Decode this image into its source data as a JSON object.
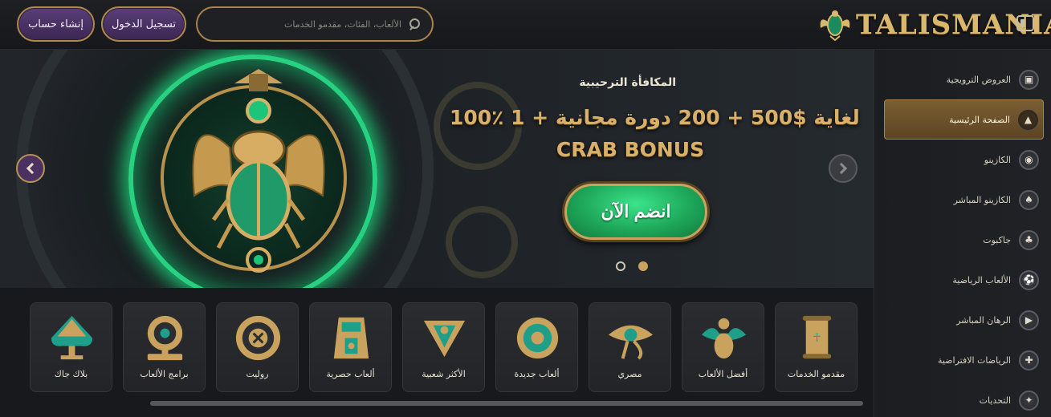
{
  "header": {
    "signup_label": "إنشاء حساب",
    "login_label": "تسجيل الدخول",
    "search_placeholder": "الألعاب، الفئات، مقدمو الخدمات",
    "logo_text": "TALISMANIA"
  },
  "hero": {
    "subtitle": "المكافأة الترحيبية",
    "line1": "100٪ لغاية $500 + 200 دورة مجانية + 1",
    "line2": "CRAB BONUS",
    "cta_label": "انضم الآن",
    "slides_total": 2,
    "active_slide": 2
  },
  "sidebar": {
    "items": [
      {
        "label": "العروض الترويجية",
        "icon": "gift-box-icon",
        "glyph": "▣",
        "active": false
      },
      {
        "label": "الصفحة الرئيسية",
        "icon": "pyramid-icon",
        "glyph": "▲",
        "active": true
      },
      {
        "label": "الكازينو",
        "icon": "casino-chip-icon",
        "glyph": "◉",
        "active": false
      },
      {
        "label": "الكازينو المباشر",
        "icon": "spade-icon",
        "glyph": "♠",
        "active": false
      },
      {
        "label": "جاكبوت",
        "icon": "clover-icon",
        "glyph": "♣",
        "active": false
      },
      {
        "label": "الألعاب الرياضية",
        "icon": "soccer-ball-icon",
        "glyph": "⚽",
        "active": false
      },
      {
        "label": "الرهان المباشر",
        "icon": "play-icon",
        "glyph": "▶",
        "active": false
      },
      {
        "label": "الرياضات الافتراضية",
        "icon": "gamepad-icon",
        "glyph": "✚",
        "active": false
      },
      {
        "label": "التحديات",
        "icon": "challenge-icon",
        "glyph": "✦",
        "active": false
      }
    ]
  },
  "categories": [
    {
      "label": "مقدمو الخدمات",
      "icon": "scroll-icon"
    },
    {
      "label": "أفضل الألعاب",
      "icon": "scarab-icon"
    },
    {
      "label": "مصري",
      "icon": "eye-of-horus-icon"
    },
    {
      "label": "ألعاب جديدة",
      "icon": "sun-disc-icon"
    },
    {
      "label": "الأكثر شعبية",
      "icon": "lotus-icon"
    },
    {
      "label": "ألعاب حصرية",
      "icon": "pharaoh-mask-icon"
    },
    {
      "label": "روليت",
      "icon": "roulette-icon"
    },
    {
      "label": "برامج الألعاب",
      "icon": "wheel-icon"
    },
    {
      "label": "بلاك جاك",
      "icon": "spade-tree-icon"
    }
  ],
  "colors": {
    "gold": "#c9a25d",
    "purple": "#4b3161",
    "green_cta": "#1ea85a",
    "teal_accent": "#1f9e8a",
    "background": "#14161a"
  }
}
